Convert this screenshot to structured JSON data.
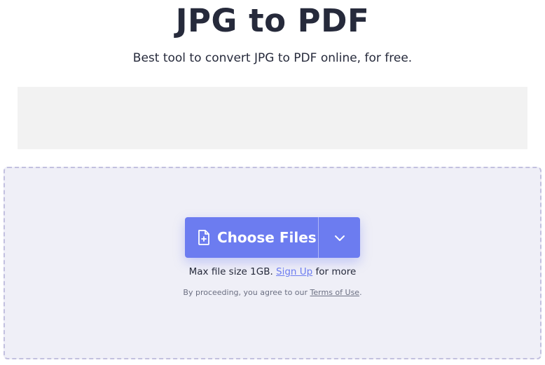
{
  "header": {
    "title": "JPG to PDF",
    "subtitle": "Best tool to convert JPG to PDF online, for free."
  },
  "upload": {
    "choose_files_label": "Choose Files",
    "file_icon": "file-plus-icon",
    "dropdown_icon": "chevron-down-icon",
    "limit_prefix": "Max file size 1GB.",
    "sign_up_label": "Sign Up",
    "limit_suffix": "for more",
    "terms_prefix": "By proceeding, you agree to our",
    "terms_link_label": "Terms of Use",
    "terms_suffix": "."
  },
  "colors": {
    "accent": "#6c7cf0",
    "dropzone_bg": "#efeff7",
    "dropzone_border": "#c2c0df",
    "ad_bg": "#f2f2f2",
    "text": "#262a3b"
  }
}
